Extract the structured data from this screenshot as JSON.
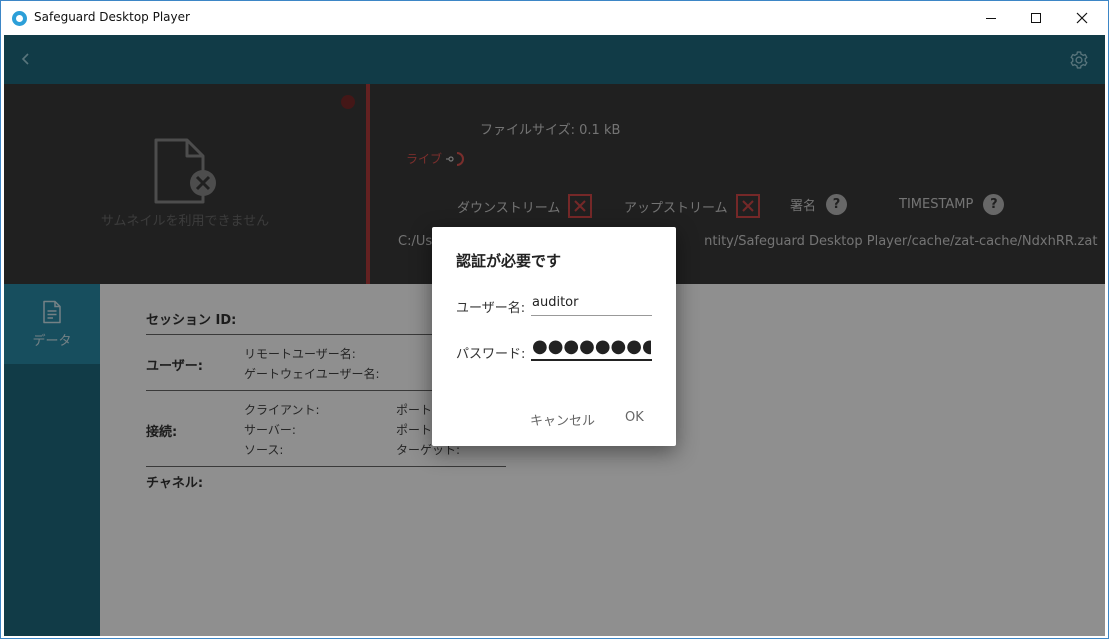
{
  "window": {
    "title": "Safeguard Desktop Player"
  },
  "header": {
    "thumbnail_unavailable": "サムネイルを利用できません",
    "file_size_label": "ファイルサイズ:",
    "file_size_value": "0.1 kB",
    "live_label": "ライブ",
    "flags": {
      "downstream": "ダウンストリーム",
      "upstream": "アップストリーム",
      "signature": "署名",
      "timestamp": "TIMESTAMP",
      "help_glyph": "?"
    },
    "path_start": "C:/Us",
    "path_end": "ntity/Safeguard Desktop Player/cache/zat-cache/NdxhRR.zat"
  },
  "sidebar": {
    "items": [
      {
        "label": "データ",
        "icon": "document-icon"
      }
    ]
  },
  "content": {
    "session_id": "セッション ID:",
    "user_section": "ユーザー:",
    "remote_user": "リモートユーザー名:",
    "gateway_user": "ゲートウェイユーザー名:",
    "connection_section": "接続:",
    "client": "クライアント:",
    "server": "サーバー:",
    "source": "ソース:",
    "port1": "ポート",
    "port2": "ポート",
    "target": "ターゲット:",
    "channel_section": "チャネル:"
  },
  "dialog": {
    "title": "認証が必要です",
    "username_label": "ユーザー名:",
    "username_value": "auditor",
    "password_label": "パスワード:",
    "password_value": "●●●●●●●●",
    "cancel": "キャンセル",
    "ok": "OK"
  }
}
